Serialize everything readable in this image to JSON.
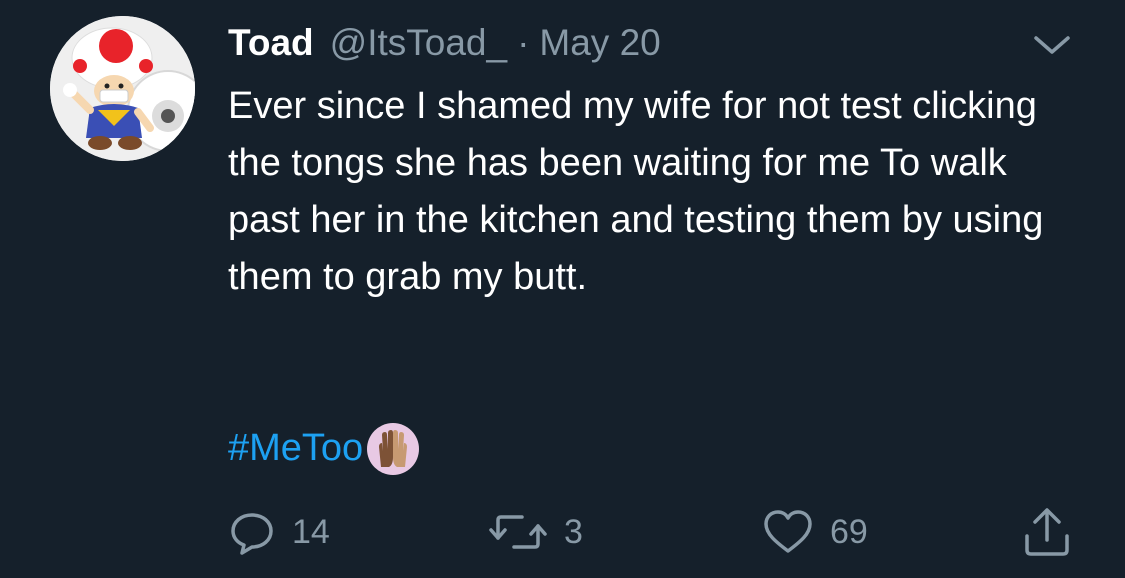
{
  "tweet": {
    "author_name": "Toad",
    "handle": "@ItsToad_",
    "separator": "·",
    "date": "May 20",
    "text": "Ever since I shamed my wife for not test clicking the tongs she has been waiting for me To walk past her in the kitchen and testing them by using them to grab my butt.",
    "hashtag": "#MeToo",
    "hashtag_emoji": "raised-hands-emoji"
  },
  "actions": {
    "reply_count": "14",
    "retweet_count": "3",
    "like_count": "69"
  },
  "icons": {
    "reply": "reply-icon",
    "retweet": "retweet-icon",
    "like": "heart-icon",
    "share": "share-icon",
    "more": "chevron-down-icon"
  },
  "colors": {
    "background": "#15202b",
    "text_primary": "#ffffff",
    "text_secondary": "#8899a6",
    "link": "#1da1f2"
  }
}
